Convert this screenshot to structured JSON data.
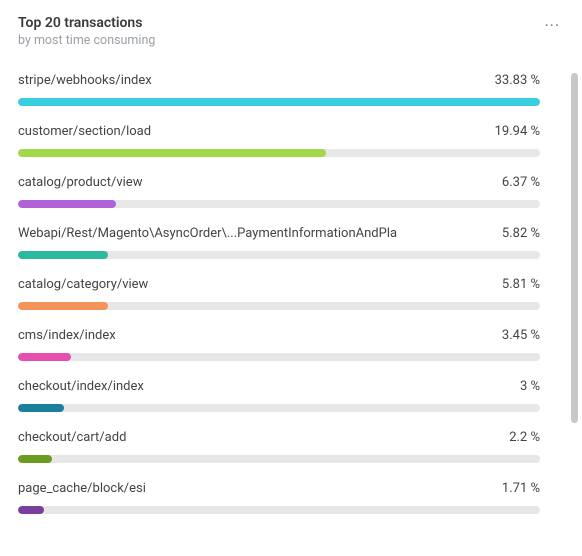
{
  "header": {
    "title": "Top 20 transactions",
    "subtitle": "by most time consuming"
  },
  "chart_data": {
    "type": "bar",
    "title": "Top 20 transactions",
    "subtitle": "by most time consuming",
    "unit": "%",
    "max_scale": 33.83,
    "series": [
      {
        "label": "stripe/webhooks/index",
        "value": 33.83,
        "value_text": "33.83 %",
        "color": "#39cde0"
      },
      {
        "label": "customer/section/load",
        "value": 19.94,
        "value_text": "19.94 %",
        "color": "#a1d94a"
      },
      {
        "label": "catalog/product/view",
        "value": 6.37,
        "value_text": "6.37 %",
        "color": "#b063d6"
      },
      {
        "label": "Webapi/Rest/Magento\\AsyncOrder\\...PaymentInformationAndPla",
        "value": 5.82,
        "value_text": "5.82 %",
        "color": "#2fb8a0"
      },
      {
        "label": "catalog/category/view",
        "value": 5.81,
        "value_text": "5.81 %",
        "color": "#f5935a"
      },
      {
        "label": "cms/index/index",
        "value": 3.45,
        "value_text": "3.45 %",
        "color": "#e64fb0"
      },
      {
        "label": "checkout/index/index",
        "value": 3.0,
        "value_text": "3 %",
        "color": "#1c7f9c"
      },
      {
        "label": "checkout/cart/add",
        "value": 2.2,
        "value_text": "2.2 %",
        "color": "#6b9b1f"
      },
      {
        "label": "page_cache/block/esi",
        "value": 1.71,
        "value_text": "1.71 %",
        "color": "#7a3e9e"
      }
    ]
  }
}
